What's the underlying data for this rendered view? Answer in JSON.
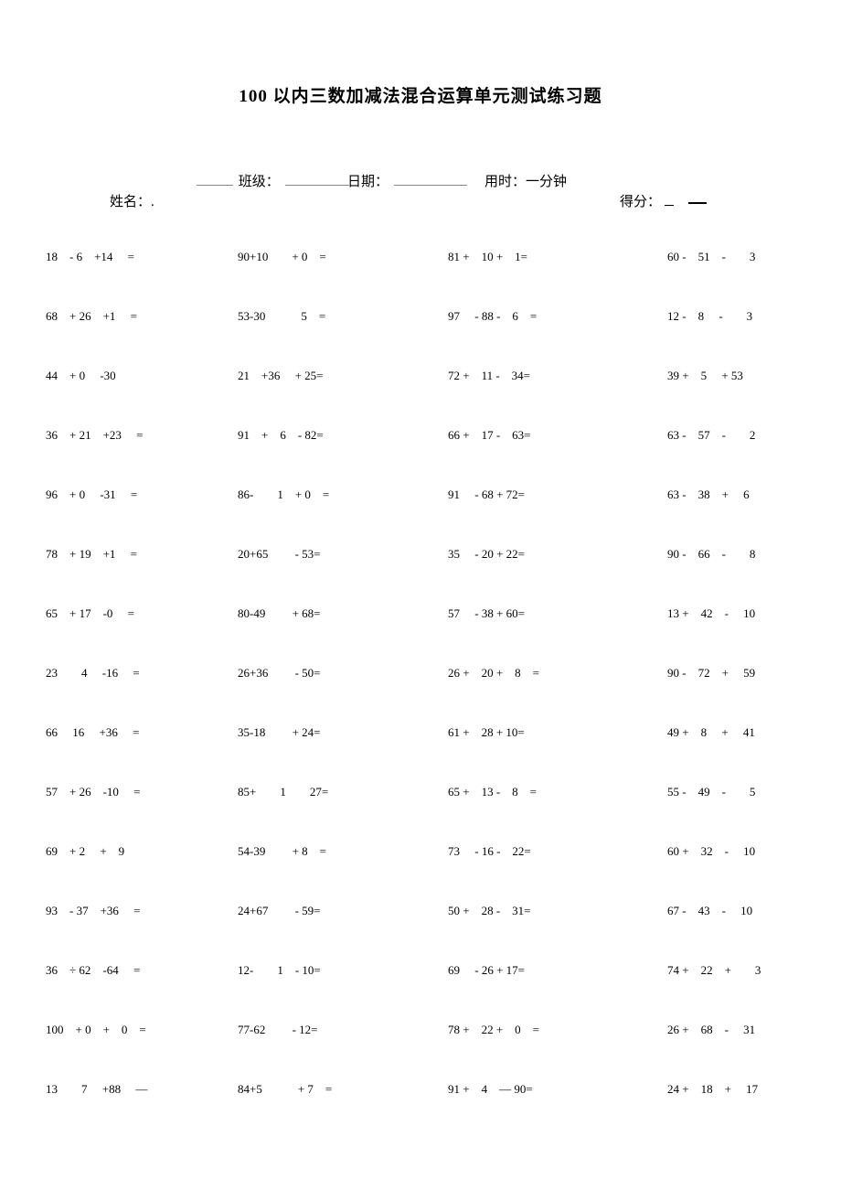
{
  "title": "100 以内三数加减法混合运算单元测试练习题",
  "header": {
    "class_label": "班级：",
    "date_label": "日期：",
    "time_label": "用时：一分钟",
    "name_label": "姓名：.",
    "score_label": "得分："
  },
  "rows": [
    {
      "c1": "18　- 6　+14　 =",
      "c2": "90+10　　+ 0　=",
      "c3": "81 +　10 +　1=",
      "c4": "60 -　51　-　　3"
    },
    {
      "c1": "68　+ 26　+1　 =",
      "c2": "53-30　　　5　=",
      "c3": "97　 - 88 -　6　=",
      "c4": "12 -　8　 -　　3"
    },
    {
      "c1": "44　+ 0　 -30",
      "c2": "21　+36　 + 25=",
      "c3": "72 +　11 -　34=",
      "c4": "39 +　5　 + 53"
    },
    {
      "c1": "36　+ 21　+23　 =",
      "c2": "91　+　6　- 82=",
      "c3": "66 +　17 -　63=",
      "c4": "63 -　57　-　　2"
    },
    {
      "c1": "96　+ 0　 -31　 =",
      "c2": "86-　　1　+ 0　=",
      "c3": "91　 - 68 + 72=",
      "c4": "63 -　38　+　 6"
    },
    {
      "c1": "78　+ 19　+1　 =",
      "c2": "20+65　　 - 53=",
      "c3": "35　 - 20 + 22=",
      "c4": "90 -　66　-　　8"
    },
    {
      "c1": "65　+ 17　-0　 =",
      "c2": "80-49　　 + 68=",
      "c3": "57　 - 38 + 60=",
      "c4": "13 +　42　-　 10"
    },
    {
      "c1": "23　　4　 -16　 =",
      "c2": "26+36　　 - 50=",
      "c3": "26 +　20 +　8　=",
      "c4": "90 -　72　+　 59"
    },
    {
      "c1": "66　 16　 +36　 =",
      "c2": "35-18　　 + 24=",
      "c3": "61 +　28 + 10=",
      "c4": "49 +　8　 +　 41"
    },
    {
      "c1": "57　+ 26　-10　 =",
      "c2": "85+　　1　　27=",
      "c3": "65 +　13 -　8　=",
      "c4": "55 -　49　-　　5"
    },
    {
      "c1": "69　+ 2　 +　9",
      "c2": "54-39　　 + 8　=",
      "c3": "73　 - 16 -　22=",
      "c4": "60 +　32　-　 10"
    },
    {
      "c1": "93　- 37　+36　 =",
      "c2": "24+67　　 - 59=",
      "c3": "50 +　28 -　31=",
      "c4": "67 -　43　-　 10"
    },
    {
      "c1": "36　÷ 62　-64　 =",
      "c2": "12-　　1　- 10=",
      "c3": "69　 - 26 + 17=",
      "c4": "74 +　22　+　　3"
    },
    {
      "c1": "100　+ 0　+　0　=",
      "c2": "77-62　　 - 12=",
      "c3": "78 +　22 +　0　=",
      "c4": "26 +　68　-　 31"
    },
    {
      "c1": "13　　7　 +88　 —",
      "c2": "84+5　　　+ 7　=",
      "c3": "91 +　4　— 90=",
      "c4": "24 +　18　+　 17"
    }
  ]
}
